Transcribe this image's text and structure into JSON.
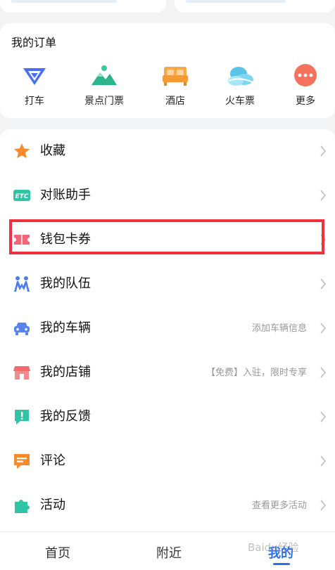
{
  "orders": {
    "title": "我的订单",
    "items": [
      {
        "label": "打车",
        "icon": "taxi-icon"
      },
      {
        "label": "景点门票",
        "icon": "mountain-ticket-icon"
      },
      {
        "label": "酒店",
        "icon": "hotel-bed-icon"
      },
      {
        "label": "火车票",
        "icon": "train-cloud-icon"
      },
      {
        "label": "更多",
        "icon": "more-dots-icon"
      }
    ]
  },
  "menu": {
    "items": [
      {
        "label": "收藏",
        "icon": "star-icon",
        "sub": ""
      },
      {
        "label": "对账助手",
        "icon": "etc-icon",
        "sub": ""
      },
      {
        "label": "钱包卡券",
        "icon": "coupon-icon",
        "sub": ""
      },
      {
        "label": "我的队伍",
        "icon": "team-icon",
        "sub": ""
      },
      {
        "label": "我的车辆",
        "icon": "car-icon",
        "sub": "添加车辆信息"
      },
      {
        "label": "我的店铺",
        "icon": "shop-icon",
        "sub": "【免费】入驻，限时专享"
      },
      {
        "label": "我的反馈",
        "icon": "feedback-icon",
        "sub": ""
      },
      {
        "label": "评论",
        "icon": "comment-icon",
        "sub": ""
      },
      {
        "label": "活动",
        "icon": "puzzle-icon",
        "sub": "查看更多活动"
      }
    ]
  },
  "tabs": [
    {
      "label": "首页",
      "active": false
    },
    {
      "label": "附近",
      "active": false
    },
    {
      "label": "我的",
      "active": true
    }
  ],
  "watermark": "Baidu经验",
  "colors": {
    "accent": "#2a6ff0",
    "highlight": "#f0303c"
  }
}
